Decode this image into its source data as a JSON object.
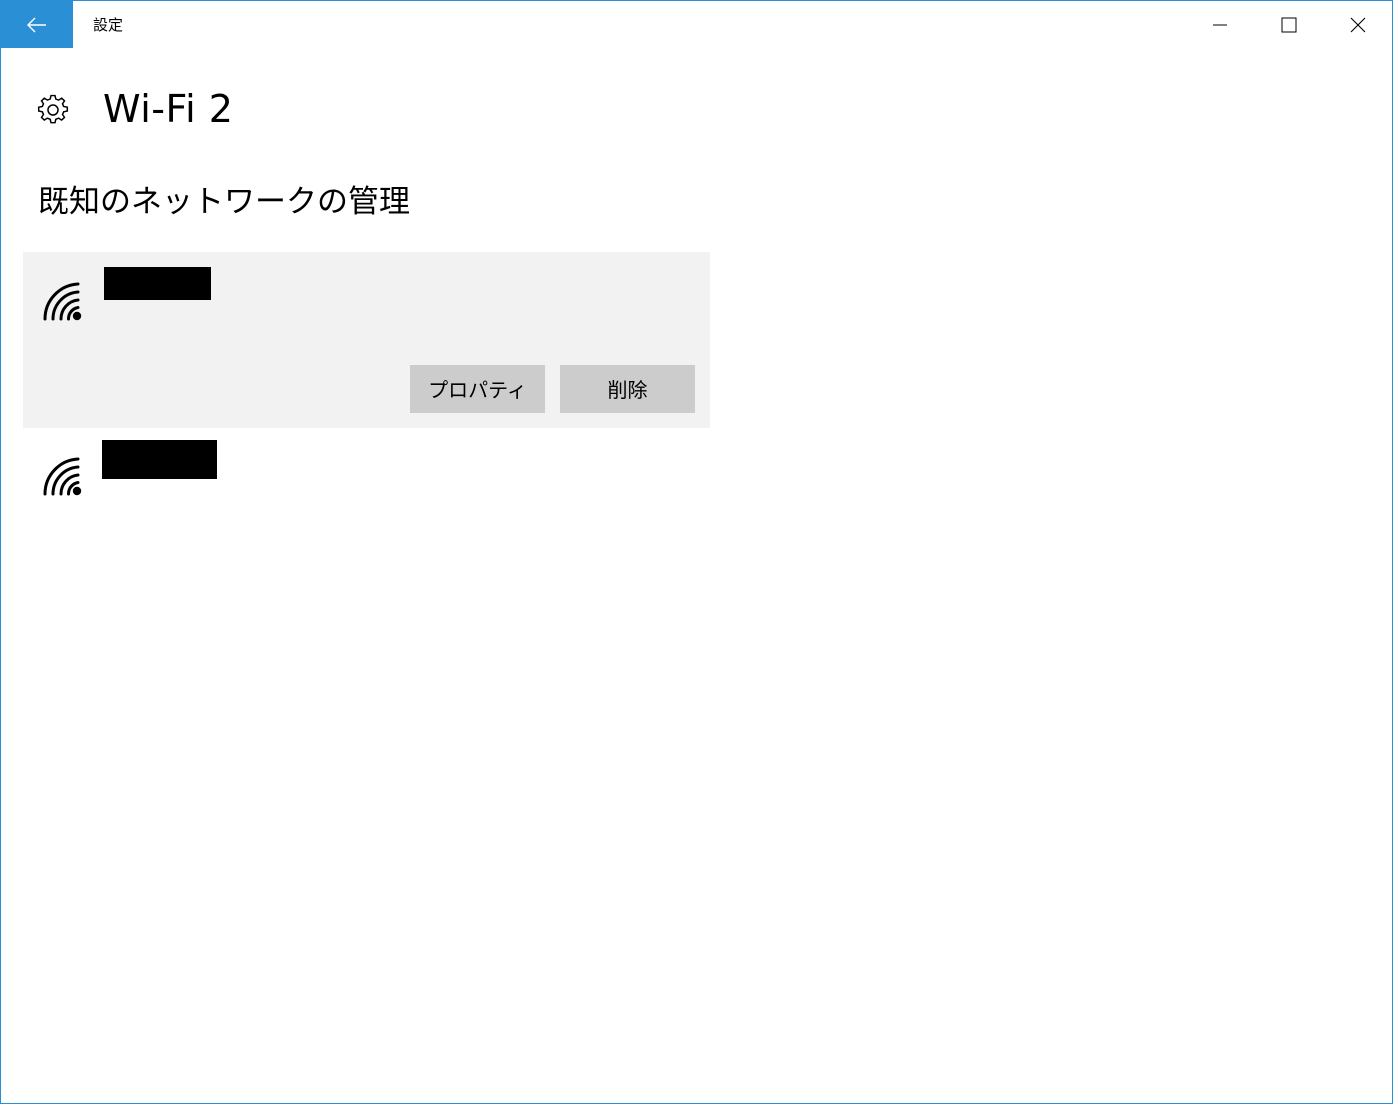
{
  "window": {
    "title": "設定",
    "accent_color": "#2b8fd6",
    "controls": {
      "minimize_icon": "minimize-icon",
      "maximize_icon": "maximize-icon",
      "close_icon": "close-icon"
    }
  },
  "header": {
    "icon": "gear-icon",
    "title": "Wi-Fi 2"
  },
  "section": {
    "title": "既知のネットワークの管理"
  },
  "networks": [
    {
      "icon": "wifi-signal-icon",
      "ssid_redacted": true,
      "selected": true,
      "properties_label": "プロパティ",
      "delete_label": "削除"
    },
    {
      "icon": "wifi-signal-icon",
      "ssid_redacted": true,
      "selected": false
    }
  ]
}
